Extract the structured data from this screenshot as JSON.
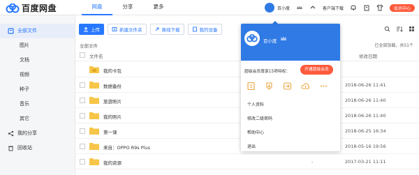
{
  "app": {
    "logo_text": "百度网盘"
  },
  "nav": {
    "tabs": [
      "网盘",
      "分享",
      "更多"
    ]
  },
  "header": {
    "username": "百小度",
    "client_download": "客户端下载",
    "vip_center": "会员中心",
    "accent": "#2878ff",
    "vip_color": "#ff5a3c"
  },
  "sidebar": {
    "all_files": "全部文件",
    "items": [
      "图片",
      "文档",
      "视频",
      "种子",
      "音乐",
      "其它"
    ],
    "my_share": "我的分享",
    "recycle": "回收站"
  },
  "toolbar": {
    "upload": "上传",
    "new_folder": "新建文件夹",
    "offline_download": "离线下载",
    "my_device": "我的设备"
  },
  "list": {
    "breadcrumb": "全部文件",
    "count_text": "已全部加载，共51个",
    "col_name": "文件名",
    "col_date": "修改日期",
    "rows": [
      {
        "name": "我的卡包",
        "size": "",
        "date": ""
      },
      {
        "name": "数据备份",
        "size": "-",
        "date": "2018-06-26 11:41"
      },
      {
        "name": "旅游照片",
        "size": "-",
        "date": "2018-06-26 11:40"
      },
      {
        "name": "我的照片",
        "size": "-",
        "date": "2018-06-26 11:40"
      },
      {
        "name": "第一课",
        "size": "-",
        "date": "2018-06-25 16:34"
      },
      {
        "name": "来自：OPPO R9s Plus",
        "size": "-",
        "date": "2018-05-16 19:56"
      },
      {
        "name": "我的资源",
        "size": "-",
        "date": "2017-03-21 11:11"
      }
    ]
  },
  "popup": {
    "name": "百小度",
    "promo": "超级会员尊享15项特权：",
    "promo_button": "开通超级会员",
    "menu": [
      "个人资料",
      "修改二级密码",
      "帮助中心",
      "退出"
    ]
  }
}
